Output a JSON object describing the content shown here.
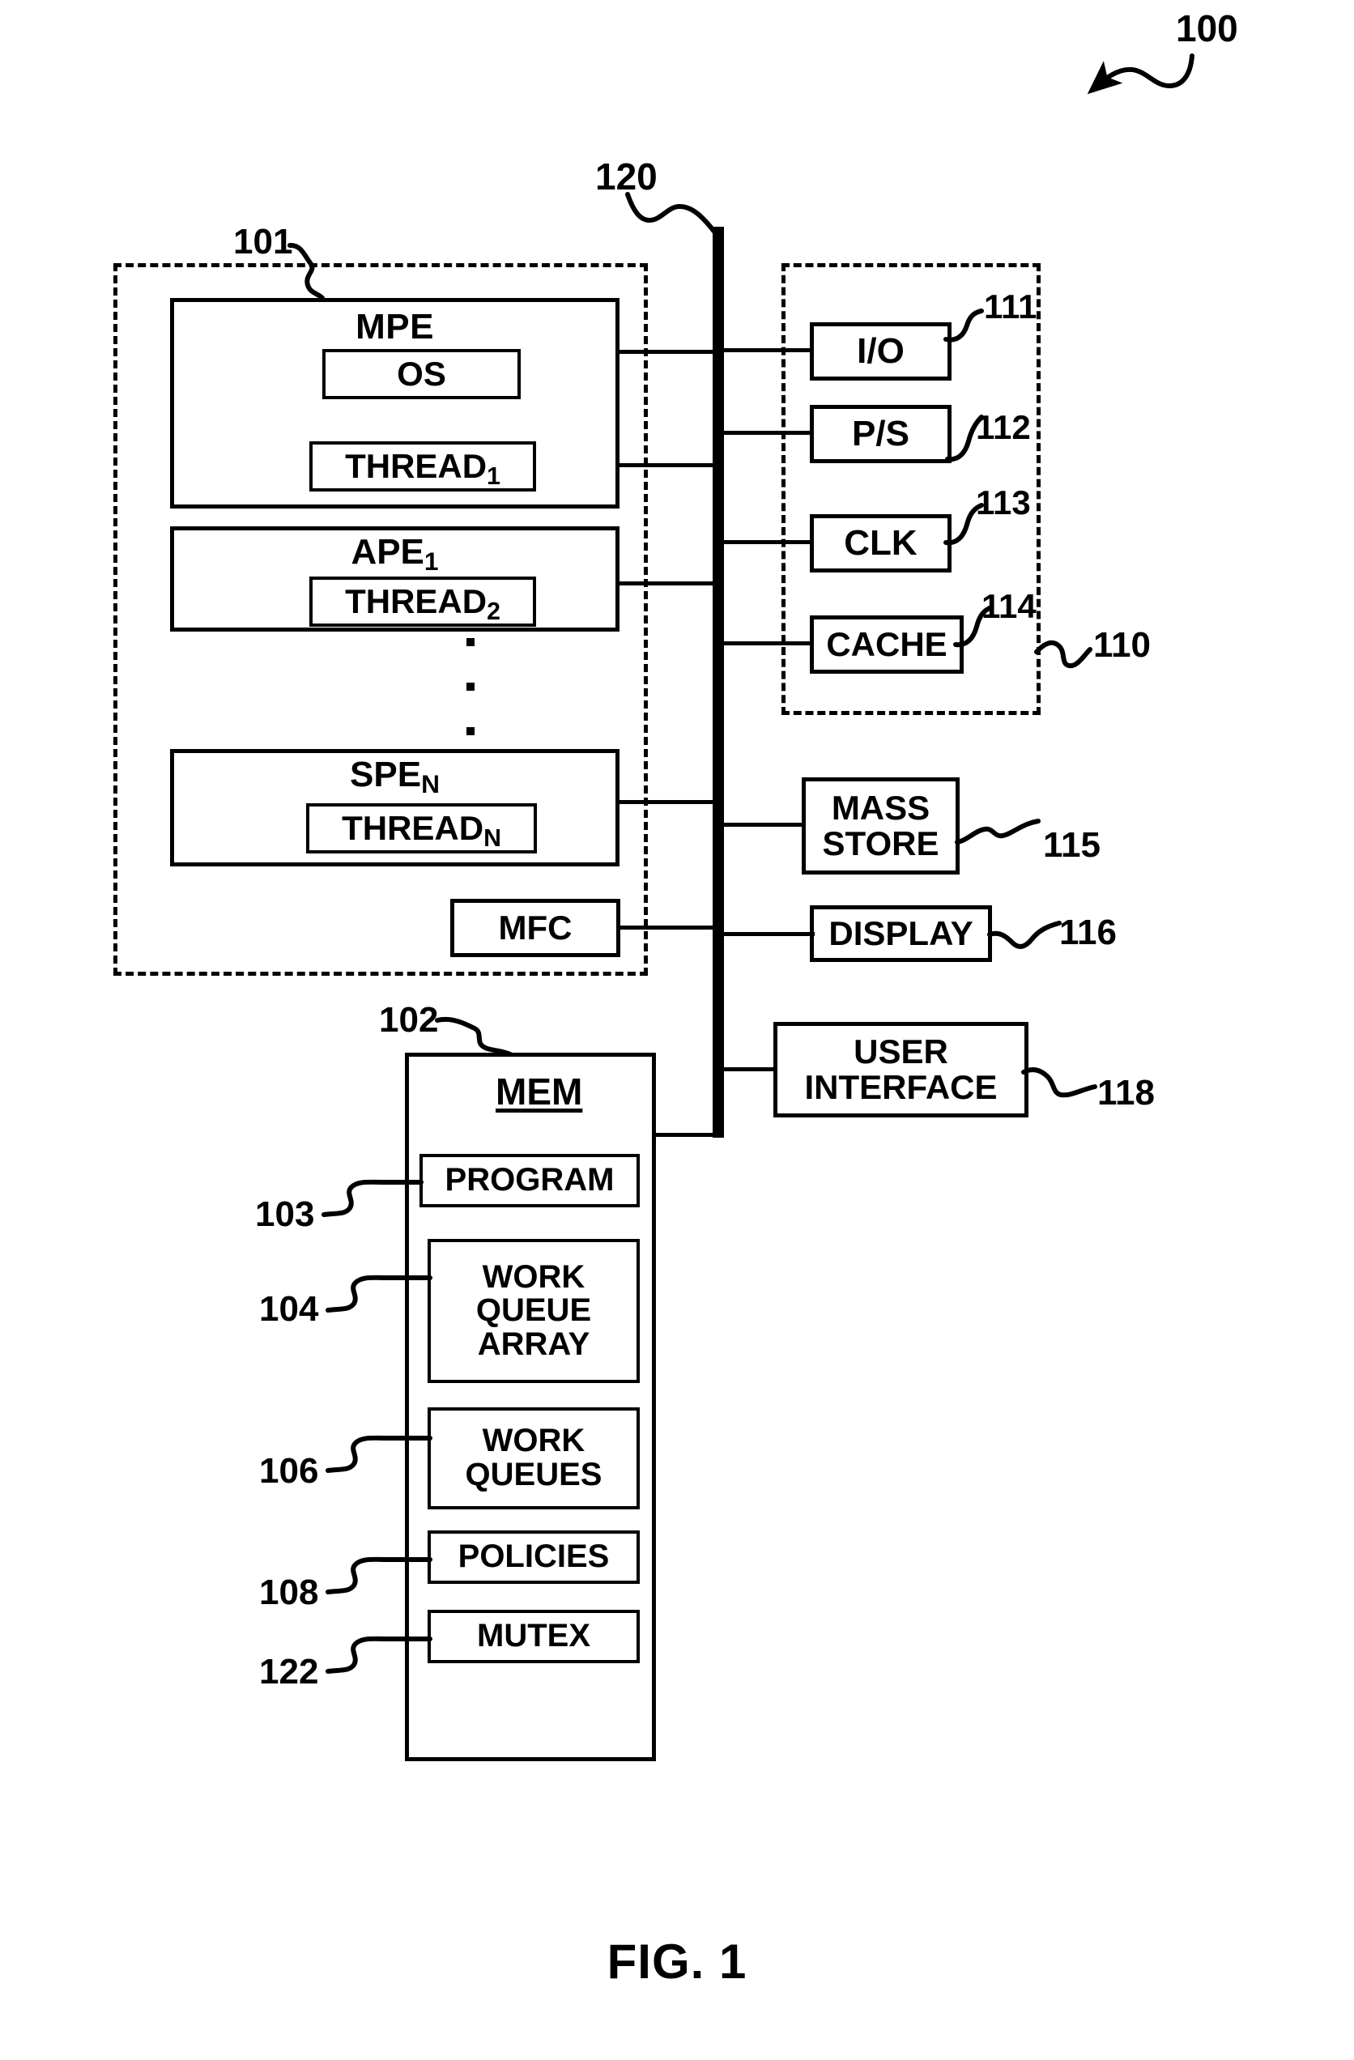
{
  "figure": {
    "caption": "FIG. 1",
    "system_ref": "100"
  },
  "bus": {
    "ref": "120"
  },
  "cell_processor": {
    "ref": "101",
    "elements": [
      {
        "name": "MPE",
        "inner": [
          {
            "label": "OS"
          },
          {
            "label": "THREAD",
            "sub": "1"
          }
        ]
      },
      {
        "name": "APE",
        "name_sub": "1",
        "inner": [
          {
            "label": "THREAD",
            "sub": "2"
          }
        ]
      },
      {
        "name": "SPE",
        "name_sub": "N",
        "inner": [
          {
            "label": "THREAD",
            "sub": "N"
          }
        ]
      }
    ],
    "mfc": {
      "label": "MFC"
    },
    "ellipsis": "vertical-dots"
  },
  "support_group": {
    "ref": "110",
    "items": [
      {
        "label": "I/O",
        "ref": "111"
      },
      {
        "label": "P/S",
        "ref": "112"
      },
      {
        "label": "CLK",
        "ref": "113"
      },
      {
        "label": "CACHE",
        "ref": "114"
      }
    ]
  },
  "peripherals": [
    {
      "label": "MASS STORE",
      "line1": "MASS",
      "line2": "STORE",
      "ref": "115"
    },
    {
      "label": "DISPLAY",
      "line1": "DISPLAY",
      "line2": "",
      "ref": "116"
    },
    {
      "label": "USER INTERFACE",
      "line1": "USER",
      "line2": "INTERFACE",
      "ref": "118"
    }
  ],
  "memory": {
    "title": "MEM",
    "ref": "102",
    "blocks": [
      {
        "line1": "PROGRAM",
        "line2": "",
        "line3": "",
        "ref": "103"
      },
      {
        "line1": "WORK",
        "line2": "QUEUE",
        "line3": "ARRAY",
        "ref": "104"
      },
      {
        "line1": "WORK",
        "line2": "QUEUES",
        "line3": "",
        "ref": "106"
      },
      {
        "line1": "POLICIES",
        "line2": "",
        "line3": "",
        "ref": "108"
      },
      {
        "line1": "MUTEX",
        "line2": "",
        "line3": "",
        "ref": "122"
      }
    ]
  },
  "colors": {
    "ink": "#000000",
    "paper": "#ffffff"
  }
}
